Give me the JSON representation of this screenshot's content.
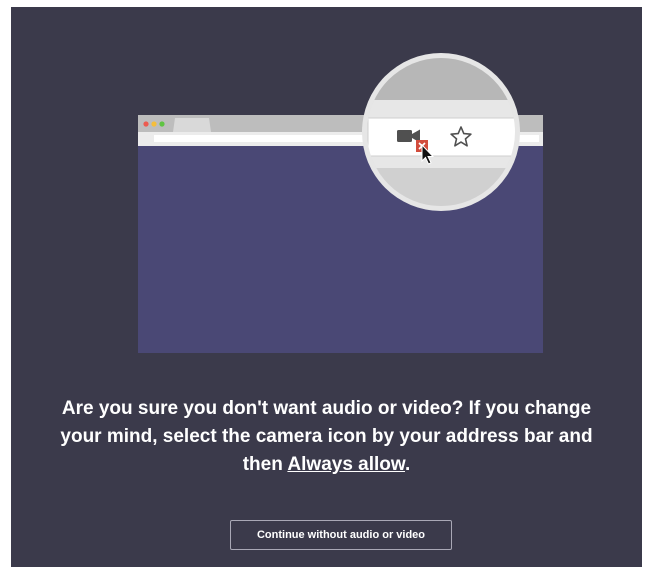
{
  "message": {
    "text_before": "Are you sure you don't want audio or video? If you change your mind, select the camera icon by your address bar and then ",
    "link": "Always allow",
    "text_after": "."
  },
  "buttons": {
    "continue_label": "Continue without audio or video"
  },
  "illustration": {
    "icons": [
      "camera-icon",
      "blocked-badge-icon",
      "cursor-icon",
      "star-icon"
    ],
    "colors": {
      "background": "#3b3a4b",
      "browser_body": "#4a4875",
      "browser_chrome": "#c2c2c2",
      "magnifier_ring": "#e6e6e6",
      "blocked_badge": "#d24c3c",
      "traffic_red": "#ec5b50",
      "traffic_yellow": "#f5be3c",
      "traffic_green": "#5fc443"
    }
  }
}
